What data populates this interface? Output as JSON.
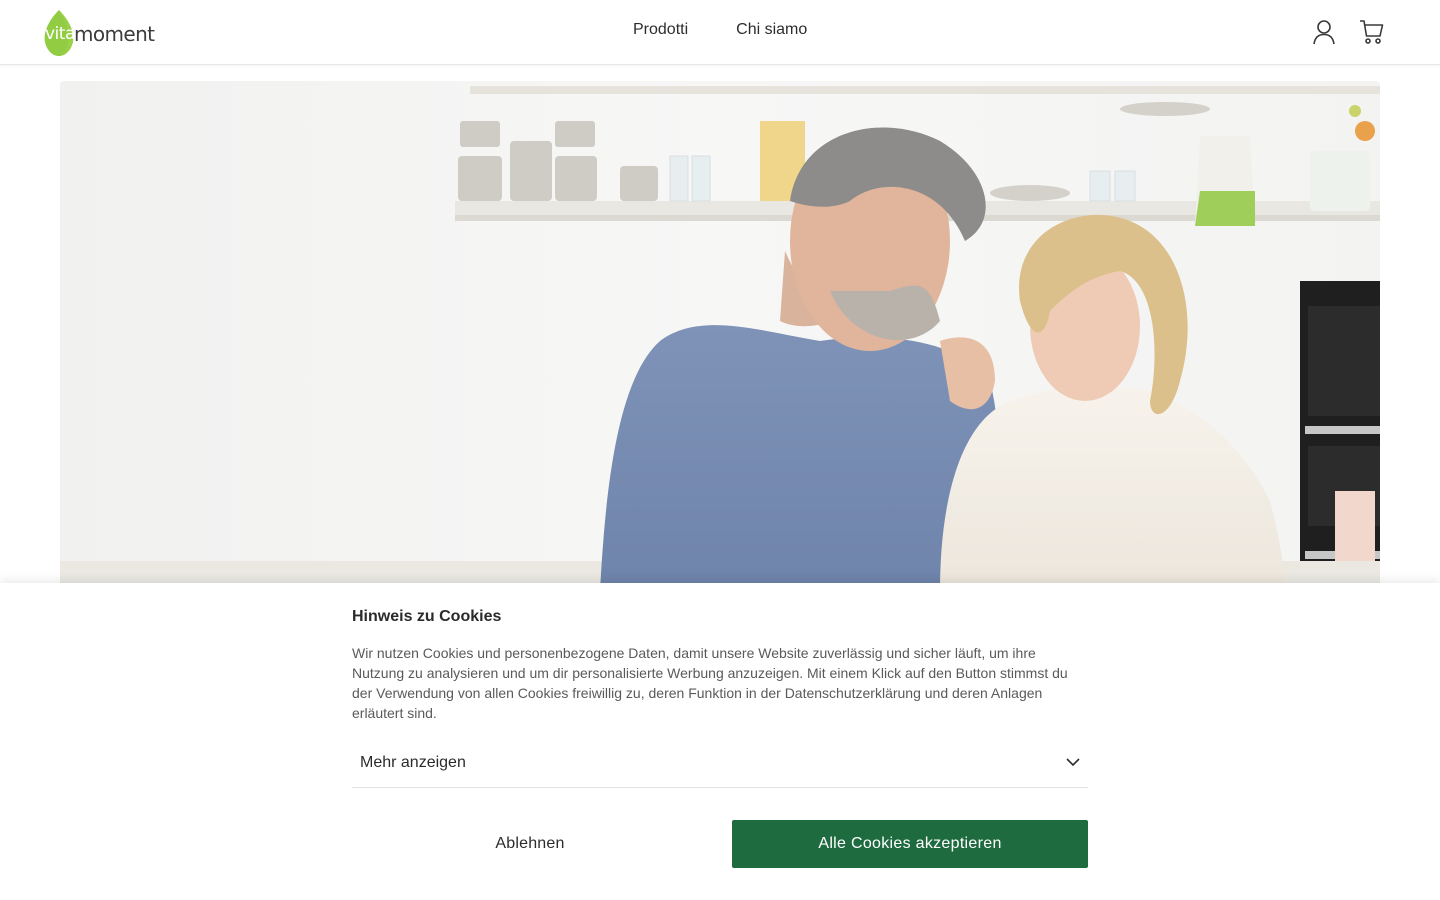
{
  "brand": {
    "logo_part1": "vita",
    "logo_part2": "moment",
    "leaf_color": "#8fcf3c",
    "logo_text_color": "#3c3c3c"
  },
  "nav": {
    "items": [
      {
        "label": "Prodotti"
      },
      {
        "label": "Chi siamo"
      }
    ]
  },
  "header_icons": [
    "user-icon",
    "cart-icon"
  ],
  "hero": {
    "image_subject": "photo"
  },
  "cookie_banner": {
    "title": "Hinweis zu Cookies",
    "text": "Wir nutzen Cookies und personenbezogene Daten, damit unsere Website zuverlässig und sicher läuft, um ihre Nutzung zu analysieren und um dir personalisierte Werbung anzuzeigen. Mit einem Klick auf den Button stimmst du der Verwendung von allen Cookies freiwillig zu, deren Funktion in der Datenschutzerklärung und deren Anlagen erläutert sind.",
    "more_label": "Mehr anzeigen",
    "decline_label": "Ablehnen",
    "accept_label": "Alle Cookies akzeptieren",
    "accept_color": "#1f6b40"
  }
}
